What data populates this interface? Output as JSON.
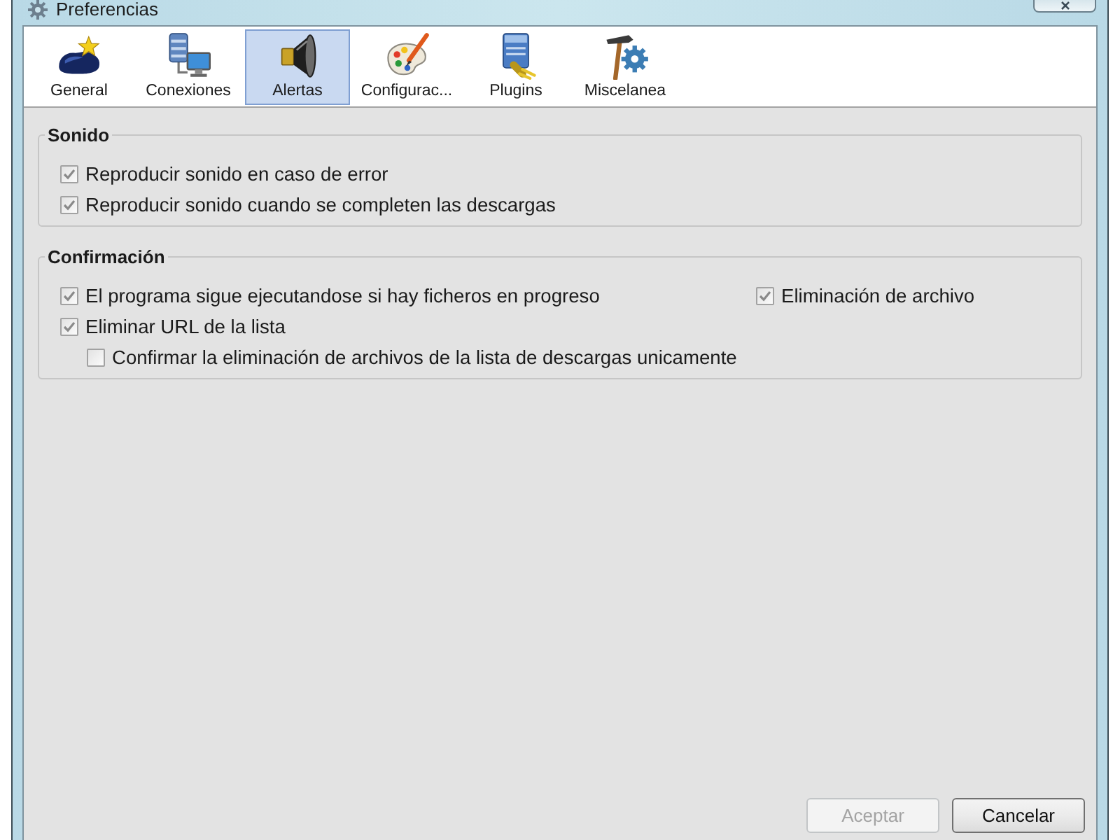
{
  "window": {
    "title": "Preferencias"
  },
  "toolbar": {
    "tabs": [
      {
        "label": "General",
        "selected": false
      },
      {
        "label": "Conexiones",
        "selected": false
      },
      {
        "label": "Alertas",
        "selected": true
      },
      {
        "label": "Configurac...",
        "selected": false
      },
      {
        "label": "Plugins",
        "selected": false
      },
      {
        "label": "Miscelanea",
        "selected": false
      }
    ]
  },
  "sections": [
    {
      "title": "Sonido",
      "columns": [
        [
          {
            "label": "Reproducir sonido en caso de error",
            "checked": true
          },
          {
            "label": "Reproducir sonido cuando se completen las descargas",
            "checked": true
          }
        ]
      ]
    },
    {
      "title": "Confirmación",
      "columns": [
        [
          {
            "label": "El programa sigue ejecutandose si hay ficheros en progreso",
            "checked": true
          },
          {
            "label": "Eliminar URL de la lista",
            "checked": true,
            "children": [
              {
                "label": "Confirmar la eliminación de archivos de la lista de descargas unicamente",
                "checked": false
              }
            ]
          }
        ],
        [
          {
            "label": "Eliminación de archivo",
            "checked": true
          }
        ]
      ]
    }
  ],
  "buttons": [
    {
      "label": "Aceptar",
      "disabled": true
    },
    {
      "label": "Cancelar",
      "disabled": false
    }
  ]
}
